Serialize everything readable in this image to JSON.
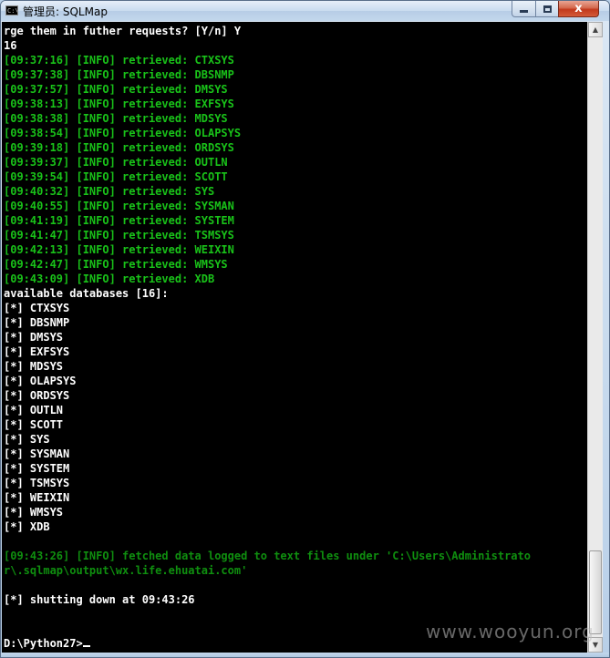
{
  "window": {
    "title": "管理员: SQLMap",
    "icon_text": "C:\\",
    "minimize": "minimize",
    "maximize": "maximize",
    "close": "x"
  },
  "colors": {
    "white": "#ffffff",
    "green": "#19c219",
    "dark_green": "#0f8f0f",
    "console_bg": "#000000"
  },
  "console": {
    "lines": [
      {
        "text": "rge them in futher requests? [Y/n] Y",
        "color": "white"
      },
      {
        "text": "16",
        "color": "white"
      },
      {
        "text": "[09:37:16] [INFO] retrieved: CTXSYS",
        "color": "green"
      },
      {
        "text": "[09:37:38] [INFO] retrieved: DBSNMP",
        "color": "green"
      },
      {
        "text": "[09:37:57] [INFO] retrieved: DMSYS",
        "color": "green"
      },
      {
        "text": "[09:38:13] [INFO] retrieved: EXFSYS",
        "color": "green"
      },
      {
        "text": "[09:38:38] [INFO] retrieved: MDSYS",
        "color": "green"
      },
      {
        "text": "[09:38:54] [INFO] retrieved: OLAPSYS",
        "color": "green"
      },
      {
        "text": "[09:39:18] [INFO] retrieved: ORDSYS",
        "color": "green"
      },
      {
        "text": "[09:39:37] [INFO] retrieved: OUTLN",
        "color": "green"
      },
      {
        "text": "[09:39:54] [INFO] retrieved: SCOTT",
        "color": "green"
      },
      {
        "text": "[09:40:32] [INFO] retrieved: SYS",
        "color": "green"
      },
      {
        "text": "[09:40:55] [INFO] retrieved: SYSMAN",
        "color": "green"
      },
      {
        "text": "[09:41:19] [INFO] retrieved: SYSTEM",
        "color": "green"
      },
      {
        "text": "[09:41:47] [INFO] retrieved: TSMSYS",
        "color": "green"
      },
      {
        "text": "[09:42:13] [INFO] retrieved: WEIXIN",
        "color": "green"
      },
      {
        "text": "[09:42:47] [INFO] retrieved: WMSYS",
        "color": "green"
      },
      {
        "text": "[09:43:09] [INFO] retrieved: XDB",
        "color": "green"
      },
      {
        "text": "available databases [16]:",
        "color": "white"
      },
      {
        "text": "[*] CTXSYS",
        "color": "white"
      },
      {
        "text": "[*] DBSNMP",
        "color": "white"
      },
      {
        "text": "[*] DMSYS",
        "color": "white"
      },
      {
        "text": "[*] EXFSYS",
        "color": "white"
      },
      {
        "text": "[*] MDSYS",
        "color": "white"
      },
      {
        "text": "[*] OLAPSYS",
        "color": "white"
      },
      {
        "text": "[*] ORDSYS",
        "color": "white"
      },
      {
        "text": "[*] OUTLN",
        "color": "white"
      },
      {
        "text": "[*] SCOTT",
        "color": "white"
      },
      {
        "text": "[*] SYS",
        "color": "white"
      },
      {
        "text": "[*] SYSMAN",
        "color": "white"
      },
      {
        "text": "[*] SYSTEM",
        "color": "white"
      },
      {
        "text": "[*] TSMSYS",
        "color": "white"
      },
      {
        "text": "[*] WEIXIN",
        "color": "white"
      },
      {
        "text": "[*] WMSYS",
        "color": "white"
      },
      {
        "text": "[*] XDB",
        "color": "white"
      },
      {
        "text": "",
        "color": "white"
      },
      {
        "text": "[09:43:26] [INFO] fetched data logged to text files under 'C:\\Users\\Administrato",
        "color": "dark_green"
      },
      {
        "text": "r\\.sqlmap\\output\\wx.life.ehuatai.com'",
        "color": "dark_green"
      },
      {
        "text": "",
        "color": "white"
      },
      {
        "text": "[*] shutting down at 09:43:26",
        "color": "white"
      },
      {
        "text": "",
        "color": "white"
      },
      {
        "text": "",
        "color": "white"
      },
      {
        "text": "D:\\Python27>",
        "color": "white",
        "cursor": true
      }
    ]
  },
  "watermark": "www.wooyun.org"
}
